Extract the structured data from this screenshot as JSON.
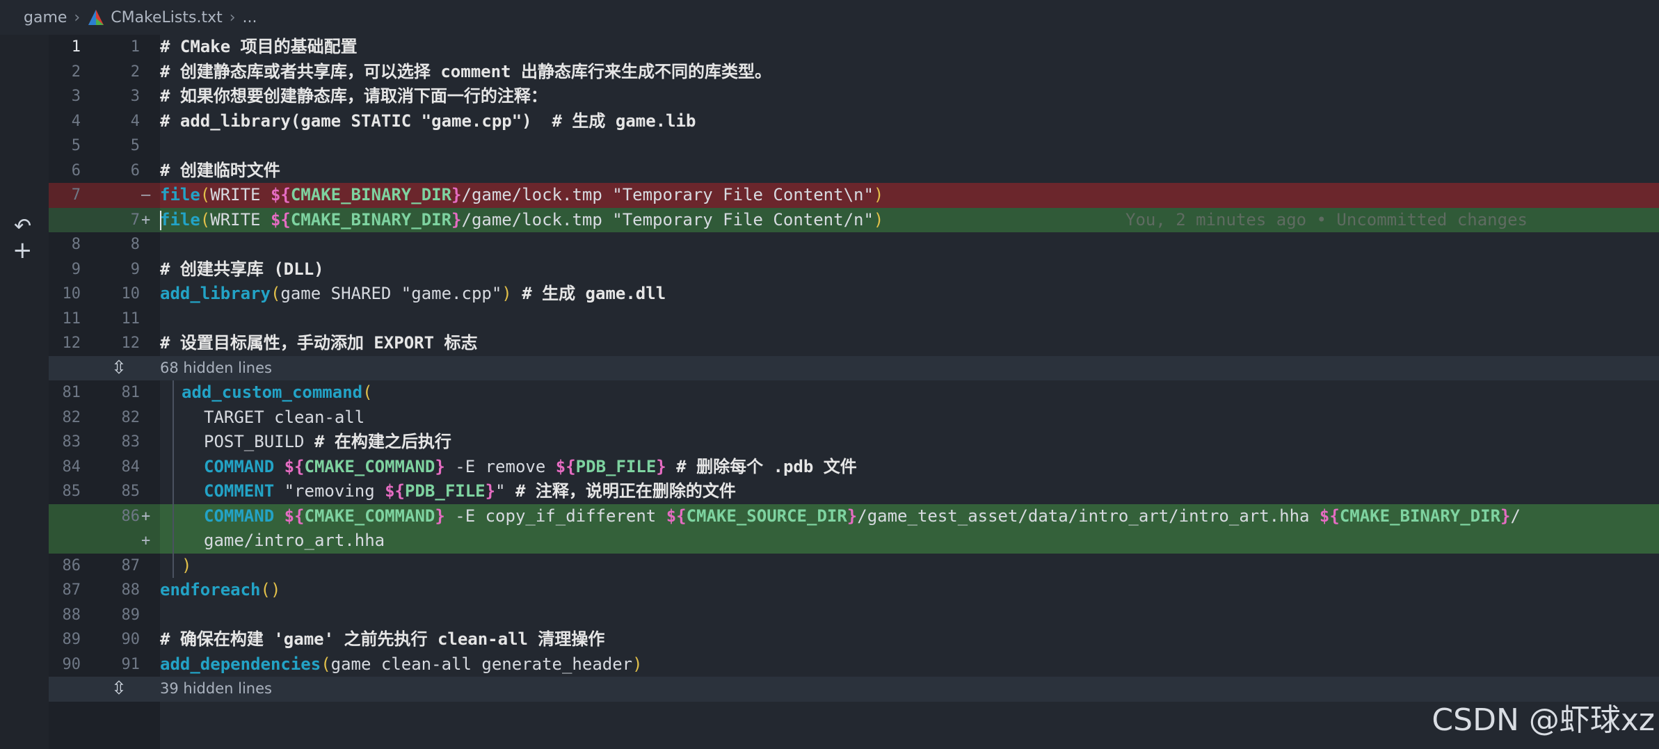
{
  "breadcrumb": {
    "folder": "game",
    "file": "CMakeLists.txt",
    "more": "..."
  },
  "blame": "You, 2 minutes ago • Uncommitted changes",
  "hidden_blocks": [
    {
      "label": "68 hidden lines"
    },
    {
      "label": "39 hidden lines"
    }
  ],
  "lines": [
    {
      "old": "1",
      "new": "1",
      "mark": "",
      "text": "# CMake 项目的基础配置"
    },
    {
      "old": "2",
      "new": "2",
      "mark": "",
      "text": "# 创建静态库或者共享库，可以选择 comment 出静态库行来生成不同的库类型。"
    },
    {
      "old": "3",
      "new": "3",
      "mark": "",
      "text": "# 如果你想要创建静态库，请取消下面一行的注释："
    },
    {
      "old": "4",
      "new": "4",
      "mark": "",
      "text": "# add_library(game STATIC \"game.cpp\")  # 生成 game.lib"
    },
    {
      "old": "5",
      "new": "5",
      "mark": "",
      "text": ""
    },
    {
      "old": "6",
      "new": "6",
      "mark": "",
      "text": "# 创建临时文件"
    },
    {
      "old": "7",
      "new": "",
      "mark": "—",
      "text": "file(WRITE ${CMAKE_BINARY_DIR}/game/lock.tmp \"Temporary File Content\\n\")"
    },
    {
      "old": "",
      "new": "7",
      "mark": "+",
      "text": "file(WRITE ${CMAKE_BINARY_DIR}/game/lock.tmp \"Temporary File Content/n\")"
    },
    {
      "old": "8",
      "new": "8",
      "mark": "",
      "text": ""
    },
    {
      "old": "9",
      "new": "9",
      "mark": "",
      "text": "# 创建共享库 (DLL)"
    },
    {
      "old": "10",
      "new": "10",
      "mark": "",
      "text": "add_library(game SHARED \"game.cpp\") # 生成 game.dll"
    },
    {
      "old": "11",
      "new": "11",
      "mark": "",
      "text": ""
    },
    {
      "old": "12",
      "new": "12",
      "mark": "",
      "text": "# 设置目标属性，手动添加 EXPORT 标志"
    },
    {
      "old": "81",
      "new": "81",
      "mark": "",
      "text": "add_custom_command("
    },
    {
      "old": "82",
      "new": "82",
      "mark": "",
      "text": "TARGET clean-all"
    },
    {
      "old": "83",
      "new": "83",
      "mark": "",
      "text": "POST_BUILD # 在构建之后执行"
    },
    {
      "old": "84",
      "new": "84",
      "mark": "",
      "text": "COMMAND ${CMAKE_COMMAND} -E remove ${PDB_FILE} # 删除每个 .pdb 文件"
    },
    {
      "old": "85",
      "new": "85",
      "mark": "",
      "text": "COMMENT \"removing ${PDB_FILE}\" # 注释，说明正在删除的文件"
    },
    {
      "old": "",
      "new": "86",
      "mark": "+",
      "text": "COMMAND ${CMAKE_COMMAND} -E copy_if_different ${CMAKE_SOURCE_DIR}/game_test_asset/data/intro_art/intro_art.hha ${CMAKE_BINARY_DIR}/"
    },
    {
      "old": "",
      "new": "",
      "mark": "+",
      "text": "game/intro_art.hha"
    },
    {
      "old": "86",
      "new": "87",
      "mark": "",
      "text": ")"
    },
    {
      "old": "87",
      "new": "88",
      "mark": "",
      "text": "endforeach()"
    },
    {
      "old": "88",
      "new": "89",
      "mark": "",
      "text": ""
    },
    {
      "old": "89",
      "new": "90",
      "mark": "",
      "text": "# 确保在构建 'game' 之前先执行 clean-all 清理操作"
    },
    {
      "old": "90",
      "new": "91",
      "mark": "",
      "text": "add_dependencies(game clean-all generate_header)"
    }
  ],
  "watermark": "CSDN @虾球xz",
  "colors": {
    "background": "#232830",
    "deleted_line": "#6b262c",
    "added_line": "#305a38",
    "function": "#23a3c6",
    "variable": "#7ed3a0",
    "dollar_brace": "#e56cc2",
    "paren": "#e2c04a"
  },
  "icons": [
    "cmake-icon",
    "chevron-right-icon",
    "revert-icon",
    "stage-icon",
    "unfold-icon"
  ]
}
